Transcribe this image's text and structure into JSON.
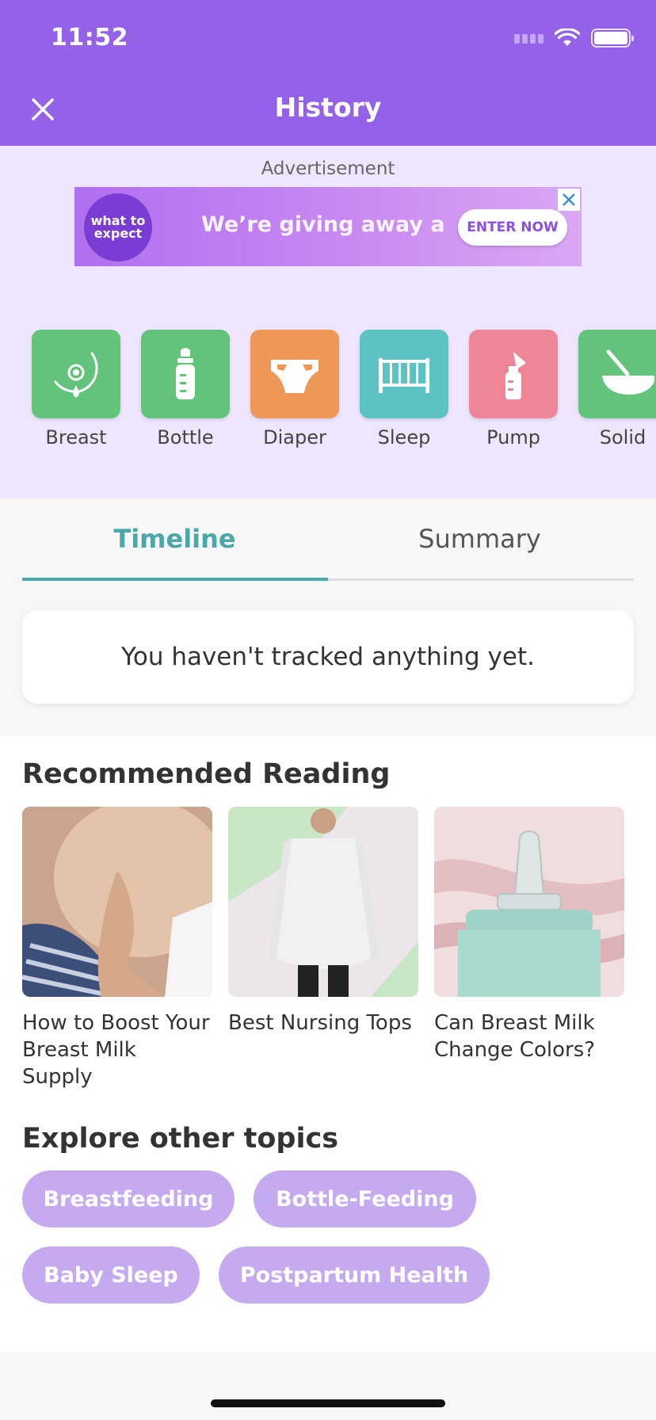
{
  "status_bar": {
    "time": "11:52"
  },
  "header": {
    "title": "History",
    "close_icon": "close-icon"
  },
  "ad": {
    "label": "Advertisement",
    "logo_text": "what to expect",
    "text": "We’re giving away a",
    "cta": "ENTER NOW"
  },
  "trackers": [
    {
      "label": "Breast",
      "color": "#62c37a",
      "icon": "breast-icon"
    },
    {
      "label": "Bottle",
      "color": "#62c37a",
      "icon": "bottle-icon"
    },
    {
      "label": "Diaper",
      "color": "#ee9858",
      "icon": "diaper-icon"
    },
    {
      "label": "Sleep",
      "color": "#5bc3c1",
      "icon": "crib-icon"
    },
    {
      "label": "Pump",
      "color": "#ef8698",
      "icon": "pump-icon"
    },
    {
      "label": "Solid",
      "color": "#62c37a",
      "icon": "bowl-icon"
    }
  ],
  "tabs": [
    {
      "label": "Timeline",
      "active": true
    },
    {
      "label": "Summary",
      "active": false
    }
  ],
  "empty_state": "You haven't tracked anything yet.",
  "recommended": {
    "title": "Recommended Reading",
    "articles": [
      {
        "title": "How to  Boost Your Breast Milk Supply"
      },
      {
        "title": "Best Nursing Tops"
      },
      {
        "title": "Can Breast Milk Change Colors?"
      }
    ]
  },
  "explore": {
    "title": "Explore other topics",
    "topics": [
      "Breastfeeding",
      "Bottle-Feeding",
      "Baby Sleep",
      "Postpartum Health"
    ]
  },
  "colors": {
    "header": "#9461e9",
    "accent": "#4aa9a8",
    "chip": "#c5aaf0",
    "tracker_bg": "#efe6fd"
  }
}
